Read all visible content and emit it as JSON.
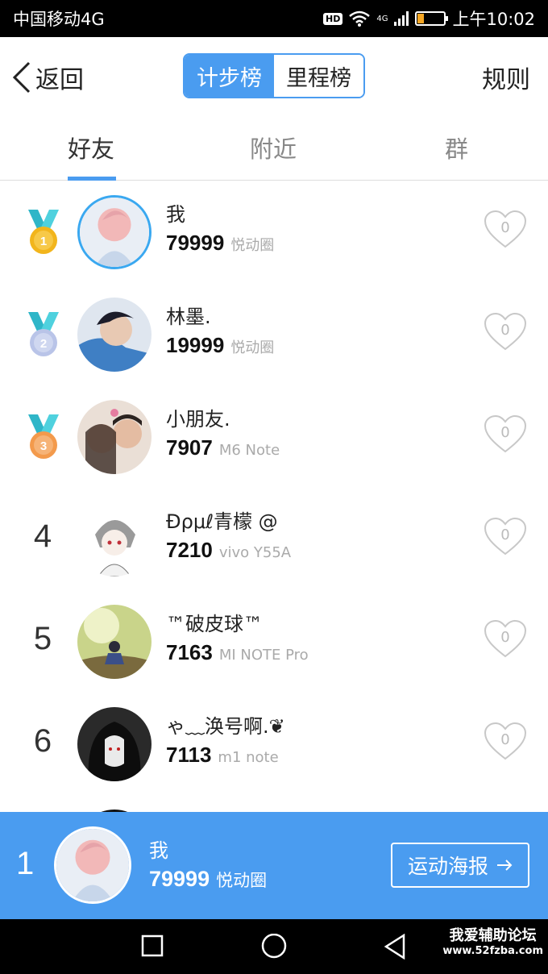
{
  "status_bar": {
    "carrier": "中国移动4G",
    "hd": "HD",
    "network": "4G",
    "time": "上午10:02"
  },
  "header": {
    "back_label": "返回",
    "segments": [
      "计步榜",
      "里程榜"
    ],
    "active_segment": 0,
    "rules_label": "规则"
  },
  "tabs": {
    "items": [
      "好友",
      "附近",
      "群"
    ],
    "active": 0
  },
  "ranking": [
    {
      "rank": "1",
      "medal": "gold-medal-icon",
      "name": "我",
      "steps": "79999",
      "device": "悦动圈",
      "likes": "0"
    },
    {
      "rank": "2",
      "medal": "silver-medal-icon",
      "name": "林墨.",
      "steps": "19999",
      "device": "悦动圈",
      "likes": "0"
    },
    {
      "rank": "3",
      "medal": "bronze-medal-icon",
      "name": "小朋友.",
      "steps": "7907",
      "device": "M6 Note",
      "likes": "0"
    },
    {
      "rank": "4",
      "name": "Ɖρμℓ青檬 @",
      "steps": "7210",
      "device": "vivo Y55A",
      "likes": "0"
    },
    {
      "rank": "5",
      "name": "™破皮球™",
      "steps": "7163",
      "device": "MI NOTE Pro",
      "likes": "0"
    },
    {
      "rank": "6",
      "name": "ゃ﹏涣号啊.❦",
      "steps": "7113",
      "device": "m1 note",
      "likes": "0"
    }
  ],
  "self": {
    "rank": "1",
    "name": "我",
    "steps": "79999",
    "device": "悦动圈",
    "poster_label": "运动海报"
  },
  "watermark": {
    "line1": "我爱辅助论坛",
    "line2": "www.52fzba.com"
  },
  "colors": {
    "accent": "#4a9cf0",
    "gold": "#f2b51c",
    "silver": "#b9c4e8",
    "bronze": "#f39a4c",
    "ribbon": "#2fb6c8"
  }
}
